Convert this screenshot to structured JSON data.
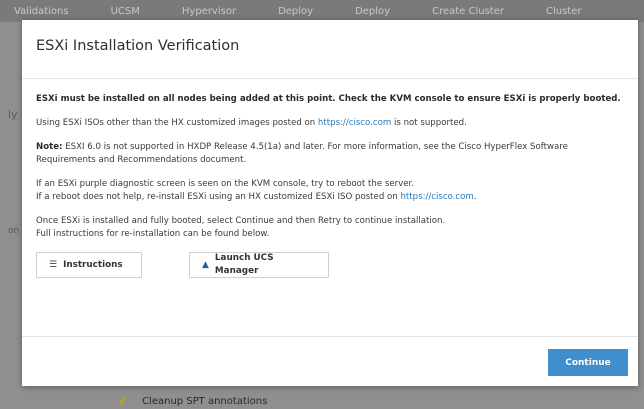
{
  "background": {
    "tabs": [
      "Validations",
      "UCSM",
      "Hypervisor",
      "Deploy",
      "Deploy",
      "Create Cluster",
      "Cluster"
    ],
    "left_fragments": [
      "ly",
      "on"
    ],
    "bottom_task": "Cleanup SPT annotations"
  },
  "modal": {
    "title": "ESXi Installation Verification",
    "paragraphs": {
      "warning": "ESXi must be installed on all nodes being added at this point. Check the KVM console to ensure ESXi is properly booted.",
      "iso_prefix": "Using ESXi ISOs other than the HX customized images posted on ",
      "iso_link": "https://cisco.com",
      "iso_suffix": " is not supported.",
      "note_label": "Note:",
      "note_text": " ESXI 6.0 is not supported in HXDP Release 4.5(1a) and later. For more information, see the Cisco HyperFlex Software Requirements and Recommendations document.",
      "purple_line1": "If an ESXi purple diagnostic screen is seen on the KVM console, try to reboot the server.",
      "purple_line2_prefix": "If a reboot does not help, re-install ESXi using an HX customized ESXi ISO posted on ",
      "purple_link": "https://cisco.com",
      "purple_suffix": ".",
      "continue_line1": "Once ESXi is installed and fully booted, select Continue and then Retry to continue installation.",
      "continue_line2": "Full instructions for re-installation can be found below."
    },
    "buttons": {
      "instructions": "Instructions",
      "launch_ucs": "Launch UCS Manager",
      "continue": "Continue"
    },
    "icons": {
      "instructions": "list-icon",
      "launch_ucs": "triangle-up-icon"
    },
    "colors": {
      "link": "#2c7ab8",
      "primary_button": "#3f8fcf"
    }
  }
}
